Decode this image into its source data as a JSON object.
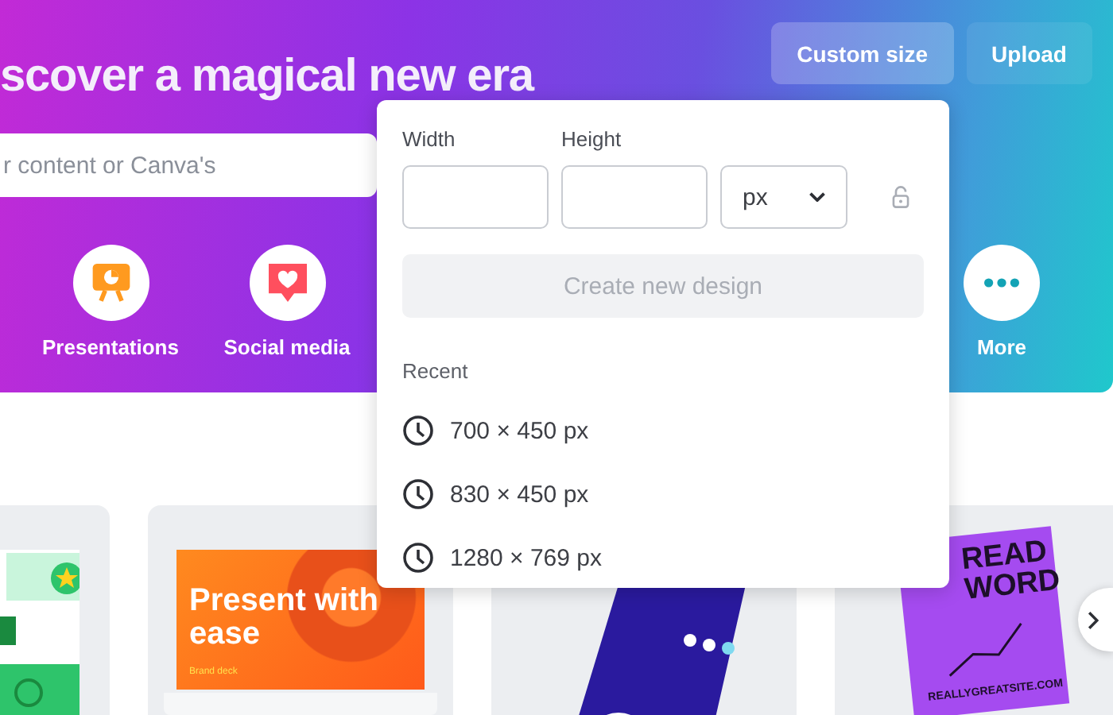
{
  "hero": {
    "heading": "scover a magical new era",
    "search": {
      "placeholder": "r content or Canva's"
    },
    "buttons": [
      {
        "label": "Custom size",
        "selected": true
      },
      {
        "label": "Upload",
        "selected": false
      }
    ],
    "categories": [
      {
        "label": "Presentations",
        "kind": "presentation"
      },
      {
        "label": "Social media",
        "kind": "social"
      },
      {
        "label": "More",
        "kind": "more"
      }
    ]
  },
  "custom_size_popover": {
    "width_label": "Width",
    "height_label": "Height",
    "unit": "px",
    "create_button": {
      "label": "Create new design",
      "disabled": true
    },
    "recent_heading": "Recent",
    "recent": [
      "700 × 450 px",
      "830 × 450 px",
      "1280 × 769 px"
    ]
  },
  "templates": [
    {
      "kind": "social"
    },
    {
      "kind": "presentation",
      "title": "Present with ease",
      "subtitle": "Brand deck"
    },
    {
      "kind": "infographic"
    },
    {
      "kind": "poster",
      "lines": [
        "READ",
        "WORD"
      ],
      "footer": "REALLYGREATSITE.COM"
    }
  ]
}
